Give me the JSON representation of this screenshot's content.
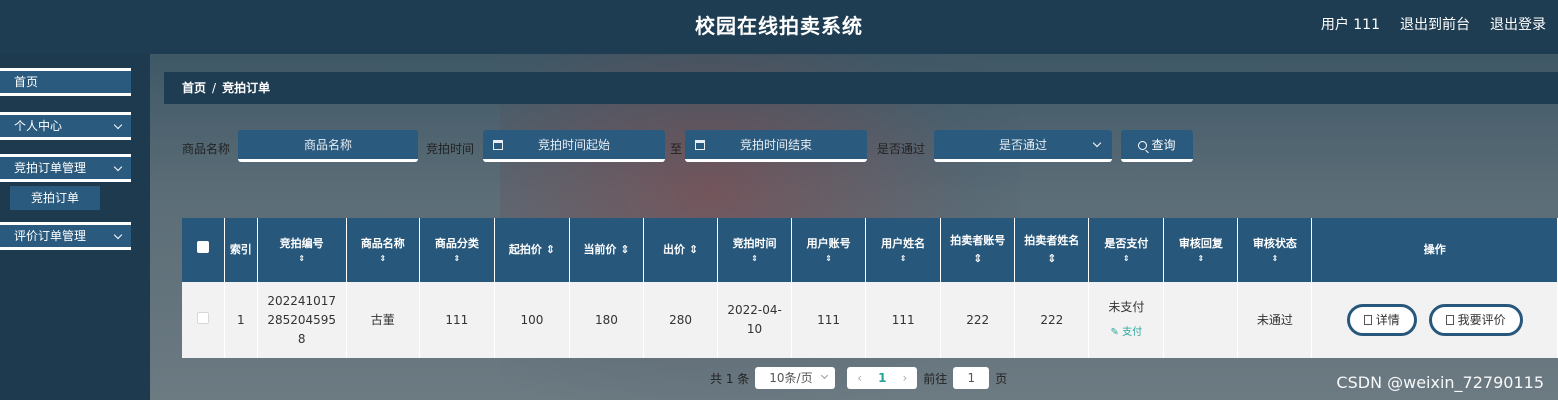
{
  "header": {
    "title": "校园在线拍卖系统",
    "user": "用户 111",
    "to_front": "退出到前台",
    "logout": "退出登录"
  },
  "sidebar": {
    "items": [
      {
        "label": "首页"
      },
      {
        "label": "个人中心"
      },
      {
        "label": "竞拍订单管理"
      },
      {
        "label": "评价订单管理"
      }
    ],
    "sub_item": "竞拍订单"
  },
  "breadcrumb": {
    "home": "首页",
    "sep": "/",
    "current": "竞拍订单"
  },
  "search": {
    "name_label": "商品名称",
    "name_placeholder": "商品名称",
    "time_label": "竞拍时间",
    "start_placeholder": "竞拍时间起始",
    "to": "至",
    "end_placeholder": "竞拍时间结束",
    "pass_label": "是否通过",
    "pass_placeholder": "是否通过",
    "query_button": "查询"
  },
  "table": {
    "headers": [
      "索引",
      "竞拍编号",
      "商品名称",
      "商品分类",
      "起拍价",
      "当前价",
      "出价",
      "竞拍时间",
      "用户账号",
      "用户姓名",
      "拍卖者账号",
      "拍卖者姓名",
      "是否支付",
      "审核回复",
      "审核状态",
      "操作"
    ],
    "sort_mark": "⇕",
    "rows": [
      {
        "index": "1",
        "bid_no": "2022410172852045958",
        "product_name": "古董",
        "category": "111",
        "start_price": "100",
        "current_price": "180",
        "offer": "280",
        "bid_time": "2022-04-10",
        "user_account": "111",
        "user_name": "111",
        "seller_account": "222",
        "seller_name": "222",
        "paid": "未支付",
        "pay_link": "支付",
        "review_reply": "",
        "review_status": "未通过",
        "detail_button": "详情",
        "review_button": "我要评价"
      }
    ]
  },
  "pager": {
    "total": "共 1 条",
    "page_size": "10条/页",
    "current_page": "1",
    "goto": "前往",
    "goto_value": "1",
    "page_unit": "页"
  },
  "watermark": "CSDN @weixin_72790115"
}
